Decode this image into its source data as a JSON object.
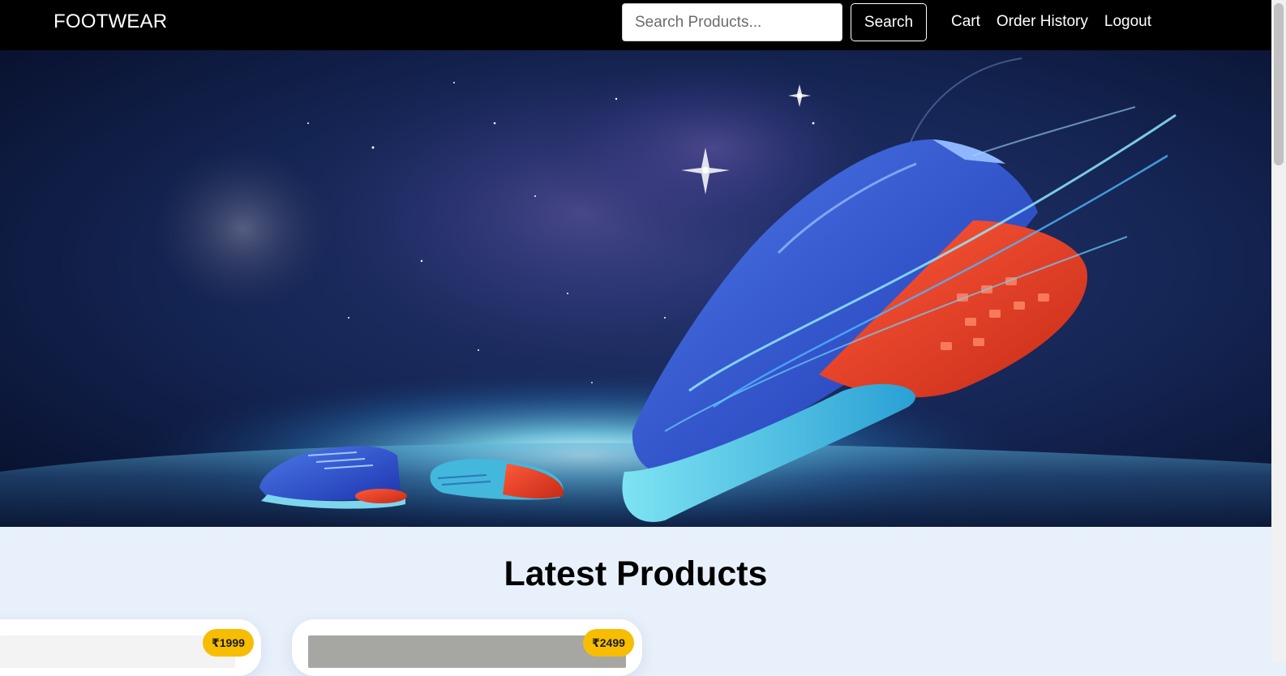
{
  "navbar": {
    "brand": "FOOTWEAR",
    "search_placeholder": "Search Products...",
    "search_button": "Search",
    "links": [
      "Cart",
      "Order History",
      "Logout"
    ]
  },
  "hero": {
    "image": "running-shoes-in-space-banner"
  },
  "products_section": {
    "title": "Latest Products",
    "cards": [
      {
        "price": "₹1999"
      },
      {
        "price": "₹2499"
      }
    ]
  },
  "colors": {
    "navbar_bg": "#000000",
    "page_bg": "#e8f0fb",
    "price_badge": "#f7bd00"
  }
}
